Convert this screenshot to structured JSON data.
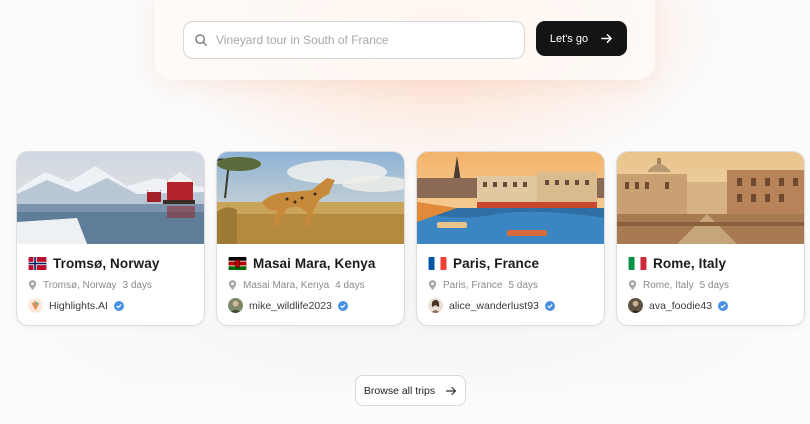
{
  "search": {
    "placeholder": "Vineyard tour in South of France",
    "value": "",
    "button_label": "Let's go"
  },
  "trips": [
    {
      "flag": "norway-flag",
      "title": "Tromsø, Norway",
      "location": "Tromsø, Norway",
      "duration": "3 days",
      "author": "Highlights.AI",
      "verified": true
    },
    {
      "flag": "kenya-flag",
      "title": "Masai Mara, Kenya",
      "location": "Masai Mara, Kenya",
      "duration": "4 days",
      "author": "mike_wildlife2023",
      "verified": true
    },
    {
      "flag": "france-flag",
      "title": "Paris, France",
      "location": "Paris, France",
      "duration": "5 days",
      "author": "alice_wanderlust93",
      "verified": true
    },
    {
      "flag": "italy-flag",
      "title": "Rome, Italy",
      "location": "Rome, Italy",
      "duration": "5 days",
      "author": "ava_foodie43",
      "verified": true
    }
  ],
  "browse_label": "Browse all trips",
  "colors": {
    "accent_dark": "#141414",
    "verified_blue": "#4a90e2",
    "glow": "#ffcdb4"
  }
}
